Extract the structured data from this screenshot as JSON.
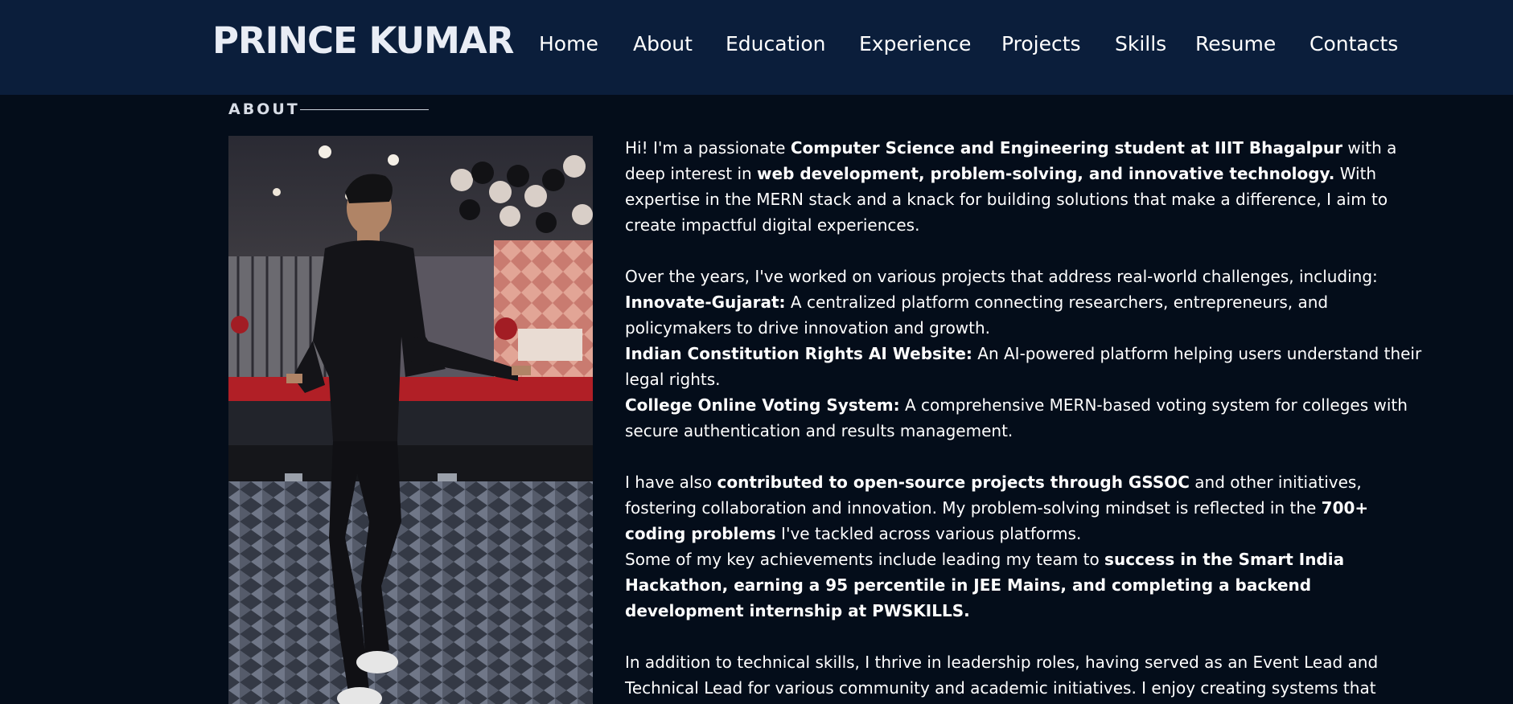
{
  "header": {
    "brand": "PRINCE KUMAR",
    "nav": [
      "Home",
      "About",
      "Education",
      "Experience",
      "Projects",
      "Skills",
      "Resume",
      "Contacts"
    ]
  },
  "about": {
    "section_title": "ABOUT",
    "para1": {
      "a": "Hi! I'm a passionate ",
      "b": "Computer Science and Engineering student at IIIT Bhagalpur",
      "c": " with a deep interest in ",
      "d": "web development, problem-solving, and innovative technology.",
      "e": " With expertise in the MERN stack and a knack for building solutions that make a difference, I aim to create impactful digital experiences."
    },
    "para2_intro": "Over the years, I've worked on various projects that address real-world challenges, including:",
    "projects": [
      {
        "name": "Innovate-Gujarat:",
        "desc": " A centralized platform connecting researchers, entrepreneurs, and policymakers to drive innovation and growth."
      },
      {
        "name": "Indian Constitution Rights AI Website:",
        "desc": " An AI-powered platform helping users understand their legal rights."
      },
      {
        "name": "College Online Voting System:",
        "desc": " A comprehensive MERN-based voting system for colleges with secure authentication and results management."
      }
    ],
    "para3": {
      "a": "I have also ",
      "b": "contributed to open-source projects through GSSOC",
      "c": " and other initiatives, fostering collaboration and innovation. My problem-solving mindset is reflected in the ",
      "d": "700+ coding problems",
      "e": " I've tackled across various platforms."
    },
    "para4": {
      "a": "Some of my key achievements include leading my team to ",
      "b": "success in the Smart India Hackathon, earning a 95 percentile in JEE Mains, and completing a backend development internship at PWSKILLS."
    },
    "para5": "In addition to technical skills, I thrive in leadership roles, having served as an Event Lead and Technical Lead for various community and academic initiatives. I enjoy creating systems that"
  },
  "colors": {
    "header_bg": "#0b1e3b",
    "page_bg": "#040d1a",
    "text": "#ffffff"
  }
}
